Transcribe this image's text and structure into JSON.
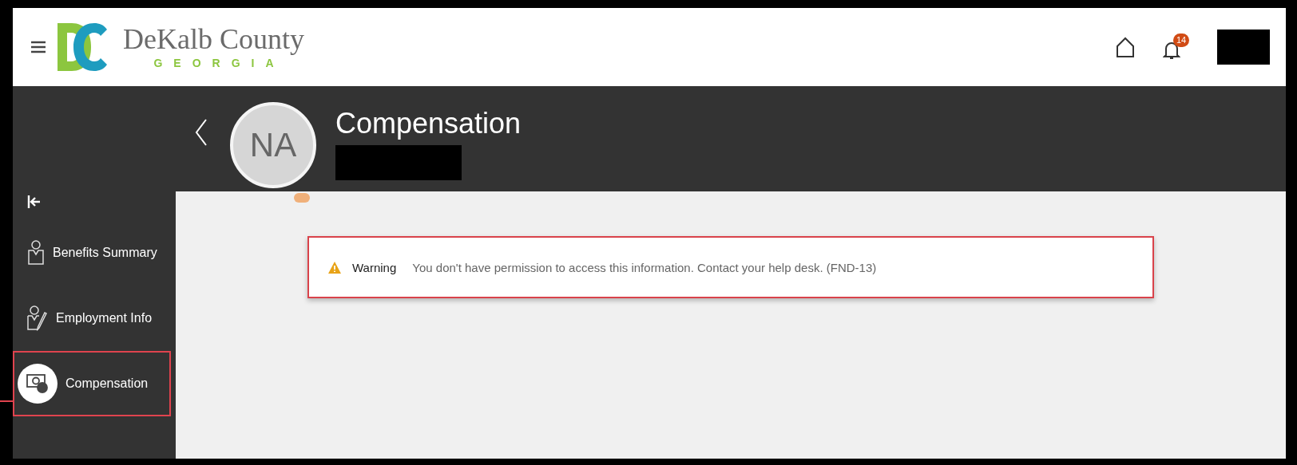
{
  "header": {
    "brand": {
      "name": "DeKalb County",
      "subtitle": "GEORGIA"
    },
    "notification_count": "14"
  },
  "sidebar": {
    "items": [
      {
        "label": "Benefits Summary",
        "kind": "benefits",
        "selected": false
      },
      {
        "label": "Employment Info",
        "kind": "employment",
        "selected": false
      },
      {
        "label": "Compensation",
        "kind": "compensation",
        "selected": true
      }
    ]
  },
  "page": {
    "title": "Compensation",
    "avatar_initials": "NA"
  },
  "warning": {
    "label": "Warning",
    "message": "You don't have permission to access this information. Contact your help desk. (FND-13)"
  }
}
